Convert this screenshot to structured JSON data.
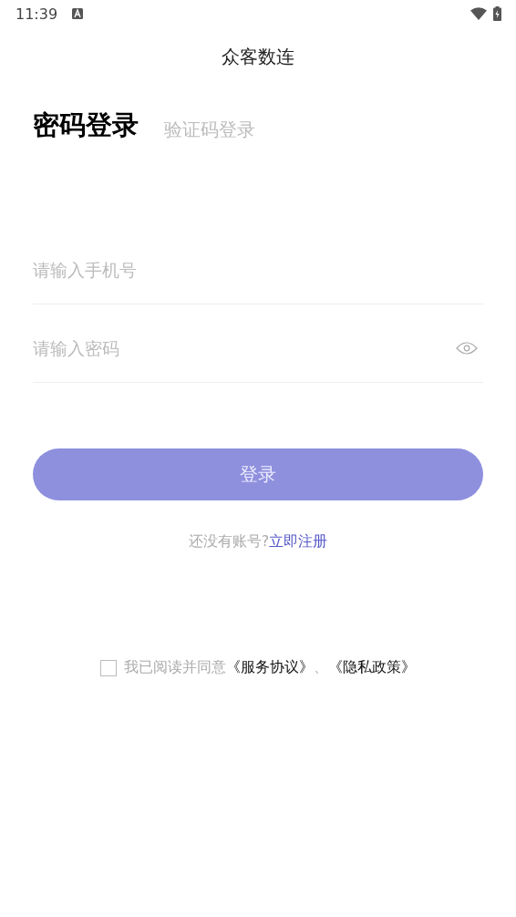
{
  "status_bar": {
    "time": "11:39"
  },
  "header": {
    "title": "众客数连"
  },
  "tabs": [
    {
      "label": "密码登录",
      "selected": true
    },
    {
      "label": "验证码登录",
      "selected": false
    }
  ],
  "fields": [
    {
      "placeholder": "请输入手机号",
      "kind": "phone"
    },
    {
      "placeholder": "请输入密码",
      "kind": "password"
    }
  ],
  "login_button": {
    "label": "登录",
    "disabled": true
  },
  "register": {
    "prompt": "还没有账号?",
    "link": "立即注册"
  },
  "agreement": {
    "checked": false,
    "text": "我已阅读并同意",
    "terms_link": "《服务协议》",
    "separator": "、",
    "privacy_link": "《隐私政策》"
  }
}
